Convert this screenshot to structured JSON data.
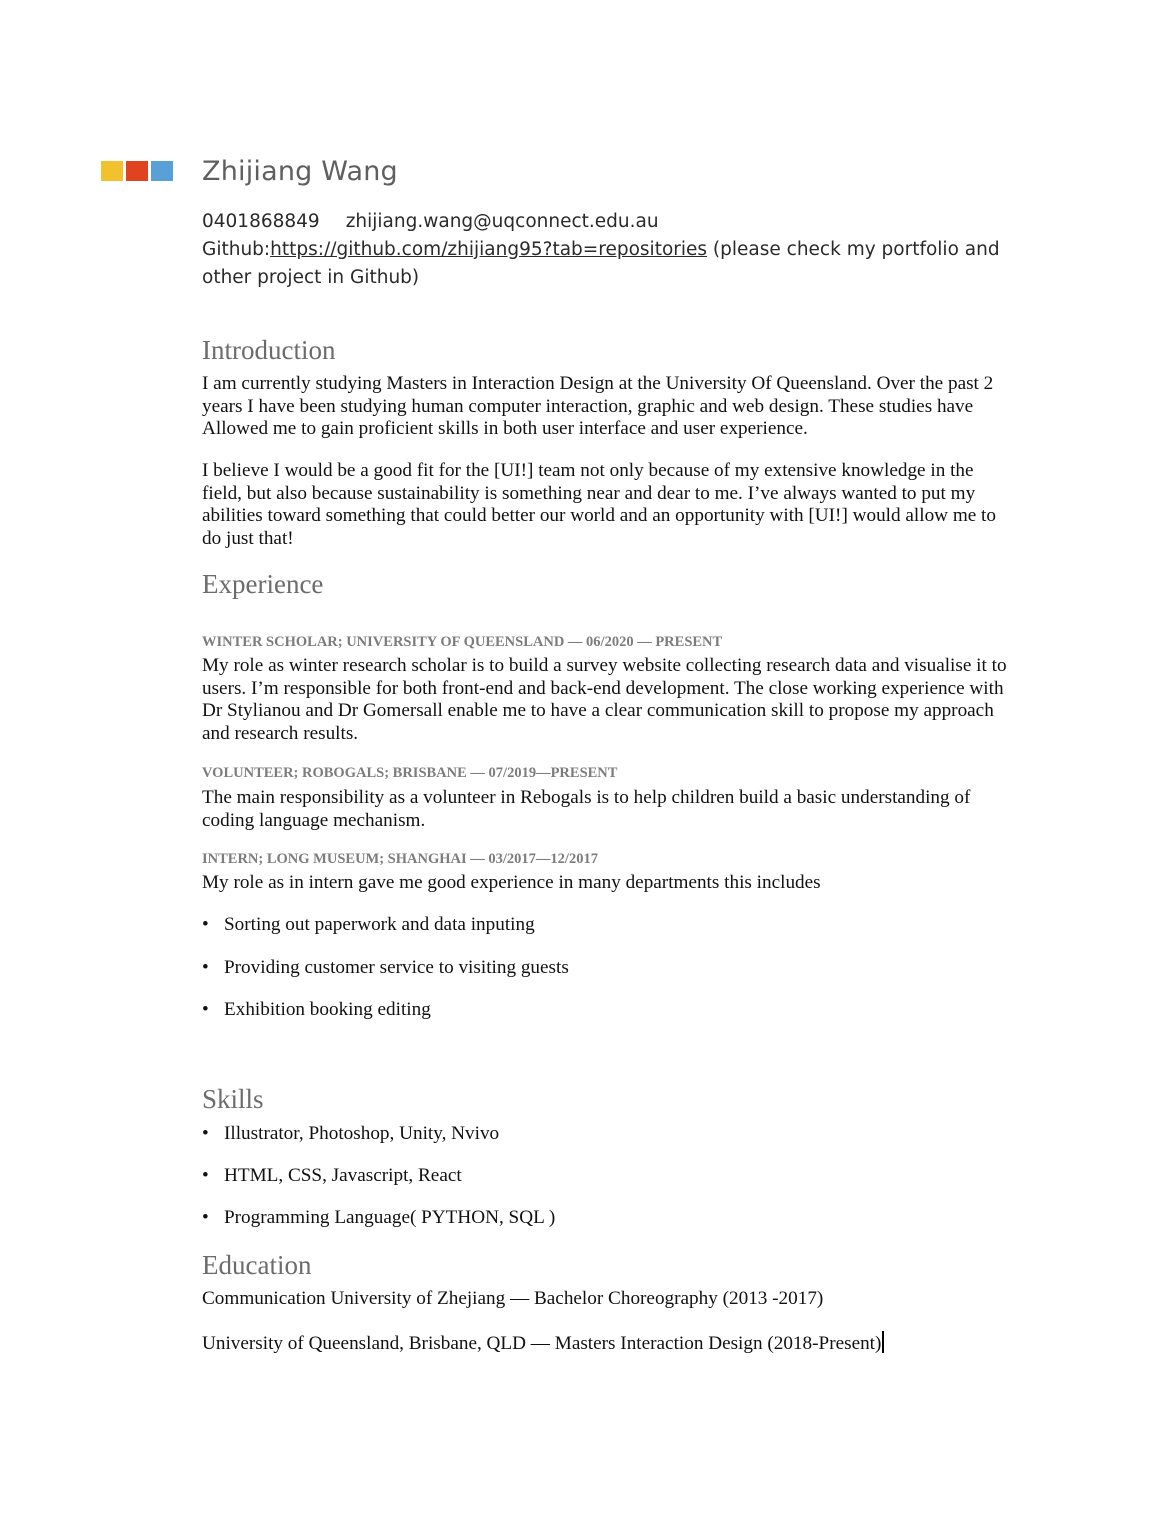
{
  "brand": {
    "colors": [
      "#f2c12e",
      "#e0431f",
      "#5aa0d8"
    ]
  },
  "header": {
    "name": "Zhijiang Wang",
    "phone": "0401868849",
    "email": "zhijiang.wang@uqconnect.edu.au",
    "github_prefix": "Github:",
    "github_url": "https://github.com/zhijiang95?tab=repositories",
    "github_note": " (please check my portfolio and other project in Github)"
  },
  "introduction": {
    "heading": "Introduction",
    "paragraphs": [
      "I am currently studying Masters in Interaction Design at the University Of Queensland. Over the past 2 years I have been studying human computer interaction, graphic and web design. These studies have Allowed me to gain proficient skills in both user interface and user experience.",
      "I believe I would be a good fit for the [UI!] team not only because of my extensive knowledge in the field, but also because sustainability is something near and dear to me. I’ve always wanted to put my abilities toward something that could better our world and an opportunity with [UI!] would allow me to do just that!"
    ]
  },
  "experience": {
    "heading": "Experience",
    "jobs": [
      {
        "title": "WINTER SCHOLAR; UNIVERSITY OF QUEENSLAND — 06/2020 — PRESENT",
        "description": "My role as winter research scholar is to build a survey website collecting research data and visualise it to users. I’m responsible for both front-end and back-end development. The close working experience with Dr Stylianou and Dr Gomersall enable me to have a clear communication skill to propose my approach and research results."
      },
      {
        "title": "VOLUNTEER; ROBOGALS; BRISBANE — 07/2019—PRESENT",
        "description": "The main responsibility as a volunteer in Rebogals is to help children build a basic understanding of coding language mechanism."
      },
      {
        "title": "INTERN; LONG MUSEUM; SHANGHAI — 03/2017—12/2017",
        "description": "My role as in intern gave me good experience in many departments this includes",
        "bullets": [
          "Sorting out paperwork and data inputing",
          "Providing customer service to visiting guests",
          "Exhibition booking editing"
        ]
      }
    ]
  },
  "skills": {
    "heading": "Skills",
    "items": [
      "Illustrator, Photoshop, Unity, Nvivo",
      "HTML, CSS, Javascript, React",
      "Programming Language( PYTHON, SQL )"
    ]
  },
  "education": {
    "heading": "Education",
    "items": [
      "Communication University of Zhejiang — Bachelor Choreography  (2013 -2017)",
      "University of Queensland, Brisbane, QLD  — Masters Interaction Design (2018-Present)"
    ]
  },
  "bullet_glyph": "•"
}
